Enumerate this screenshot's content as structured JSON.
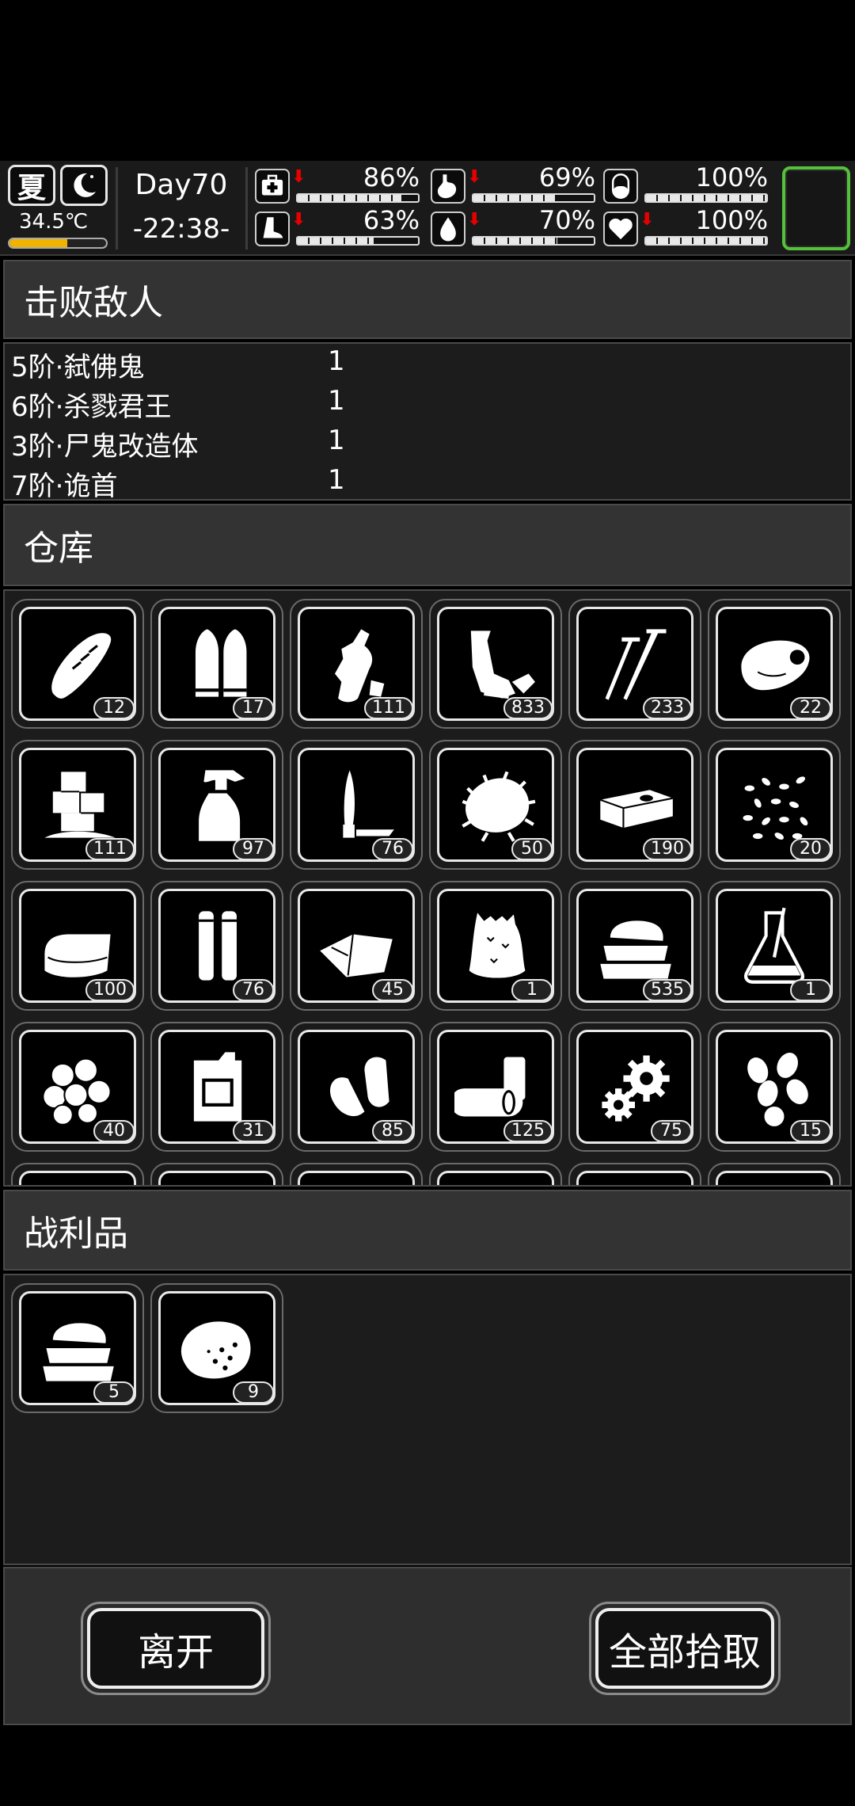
{
  "status": {
    "season": "夏",
    "temperature": "34.5℃",
    "temperature_level": 0.6,
    "day": "Day70",
    "time": "-22:38-",
    "stats": [
      {
        "name": "health",
        "icon": "medkit-icon",
        "value": "86%",
        "level": 0.86,
        "declining": true
      },
      {
        "name": "hunger",
        "icon": "stomach-icon",
        "value": "69%",
        "level": 0.69,
        "declining": true
      },
      {
        "name": "pill",
        "icon": "pill-icon",
        "value": "100%",
        "level": 1.0,
        "declining": false
      },
      {
        "name": "stamina",
        "icon": "foot-icon",
        "value": "63%",
        "level": 0.63,
        "declining": true
      },
      {
        "name": "thirst",
        "icon": "water-drop-icon",
        "value": "70%",
        "level": 0.7,
        "declining": true
      },
      {
        "name": "mood",
        "icon": "heart-icon",
        "value": "100%",
        "level": 1.0,
        "declining": true
      }
    ],
    "highlight_color": "#55c13a"
  },
  "sections": {
    "enemies_title": "击败敌人",
    "storage_title": "仓库",
    "loot_title": "战利品"
  },
  "enemies": [
    {
      "name": "5阶·弑佛鬼",
      "count": "1"
    },
    {
      "name": "6阶·杀戮君王",
      "count": "1"
    },
    {
      "name": "3阶·尸鬼改造体",
      "count": "1"
    },
    {
      "name": "7阶·诡首",
      "count": "1"
    }
  ],
  "storage": [
    {
      "icon": "bread-icon",
      "count": "12"
    },
    {
      "icon": "bullets-icon",
      "count": "17"
    },
    {
      "icon": "crushed-bottle-icon",
      "count": "111"
    },
    {
      "icon": "scrap-pipe-icon",
      "count": "833"
    },
    {
      "icon": "nails-icon",
      "count": "233"
    },
    {
      "icon": "meat-chunk-icon",
      "count": "22"
    },
    {
      "icon": "ice-cubes-icon",
      "count": "111"
    },
    {
      "icon": "spray-bottle-icon",
      "count": "97"
    },
    {
      "icon": "knife-bullet-icon",
      "count": "76"
    },
    {
      "icon": "fur-tuft-icon",
      "count": "50"
    },
    {
      "icon": "cash-stack-icon",
      "count": "190"
    },
    {
      "icon": "seeds-icon",
      "count": "20"
    },
    {
      "icon": "folded-cloth-icon",
      "count": "100"
    },
    {
      "icon": "shell-cartridges-icon",
      "count": "76"
    },
    {
      "icon": "bandage-cloth-icon",
      "count": "45"
    },
    {
      "icon": "sack-icon",
      "count": "1"
    },
    {
      "icon": "towel-stack-icon",
      "count": "535"
    },
    {
      "icon": "flask-icon",
      "count": "1"
    },
    {
      "icon": "cotton-balls-icon",
      "count": "40"
    },
    {
      "icon": "jerrycan-icon",
      "count": "31"
    },
    {
      "icon": "earplugs-icon",
      "count": "85"
    },
    {
      "icon": "cans-icon",
      "count": "125"
    },
    {
      "icon": "gears-icon",
      "count": "75"
    },
    {
      "icon": "nuts-icon",
      "count": "15"
    }
  ],
  "loot": [
    {
      "icon": "towel-stack-icon",
      "count": "5"
    },
    {
      "icon": "raw-meat-icon",
      "count": "9"
    }
  ],
  "buttons": {
    "leave": "离开",
    "take_all": "全部拾取"
  }
}
